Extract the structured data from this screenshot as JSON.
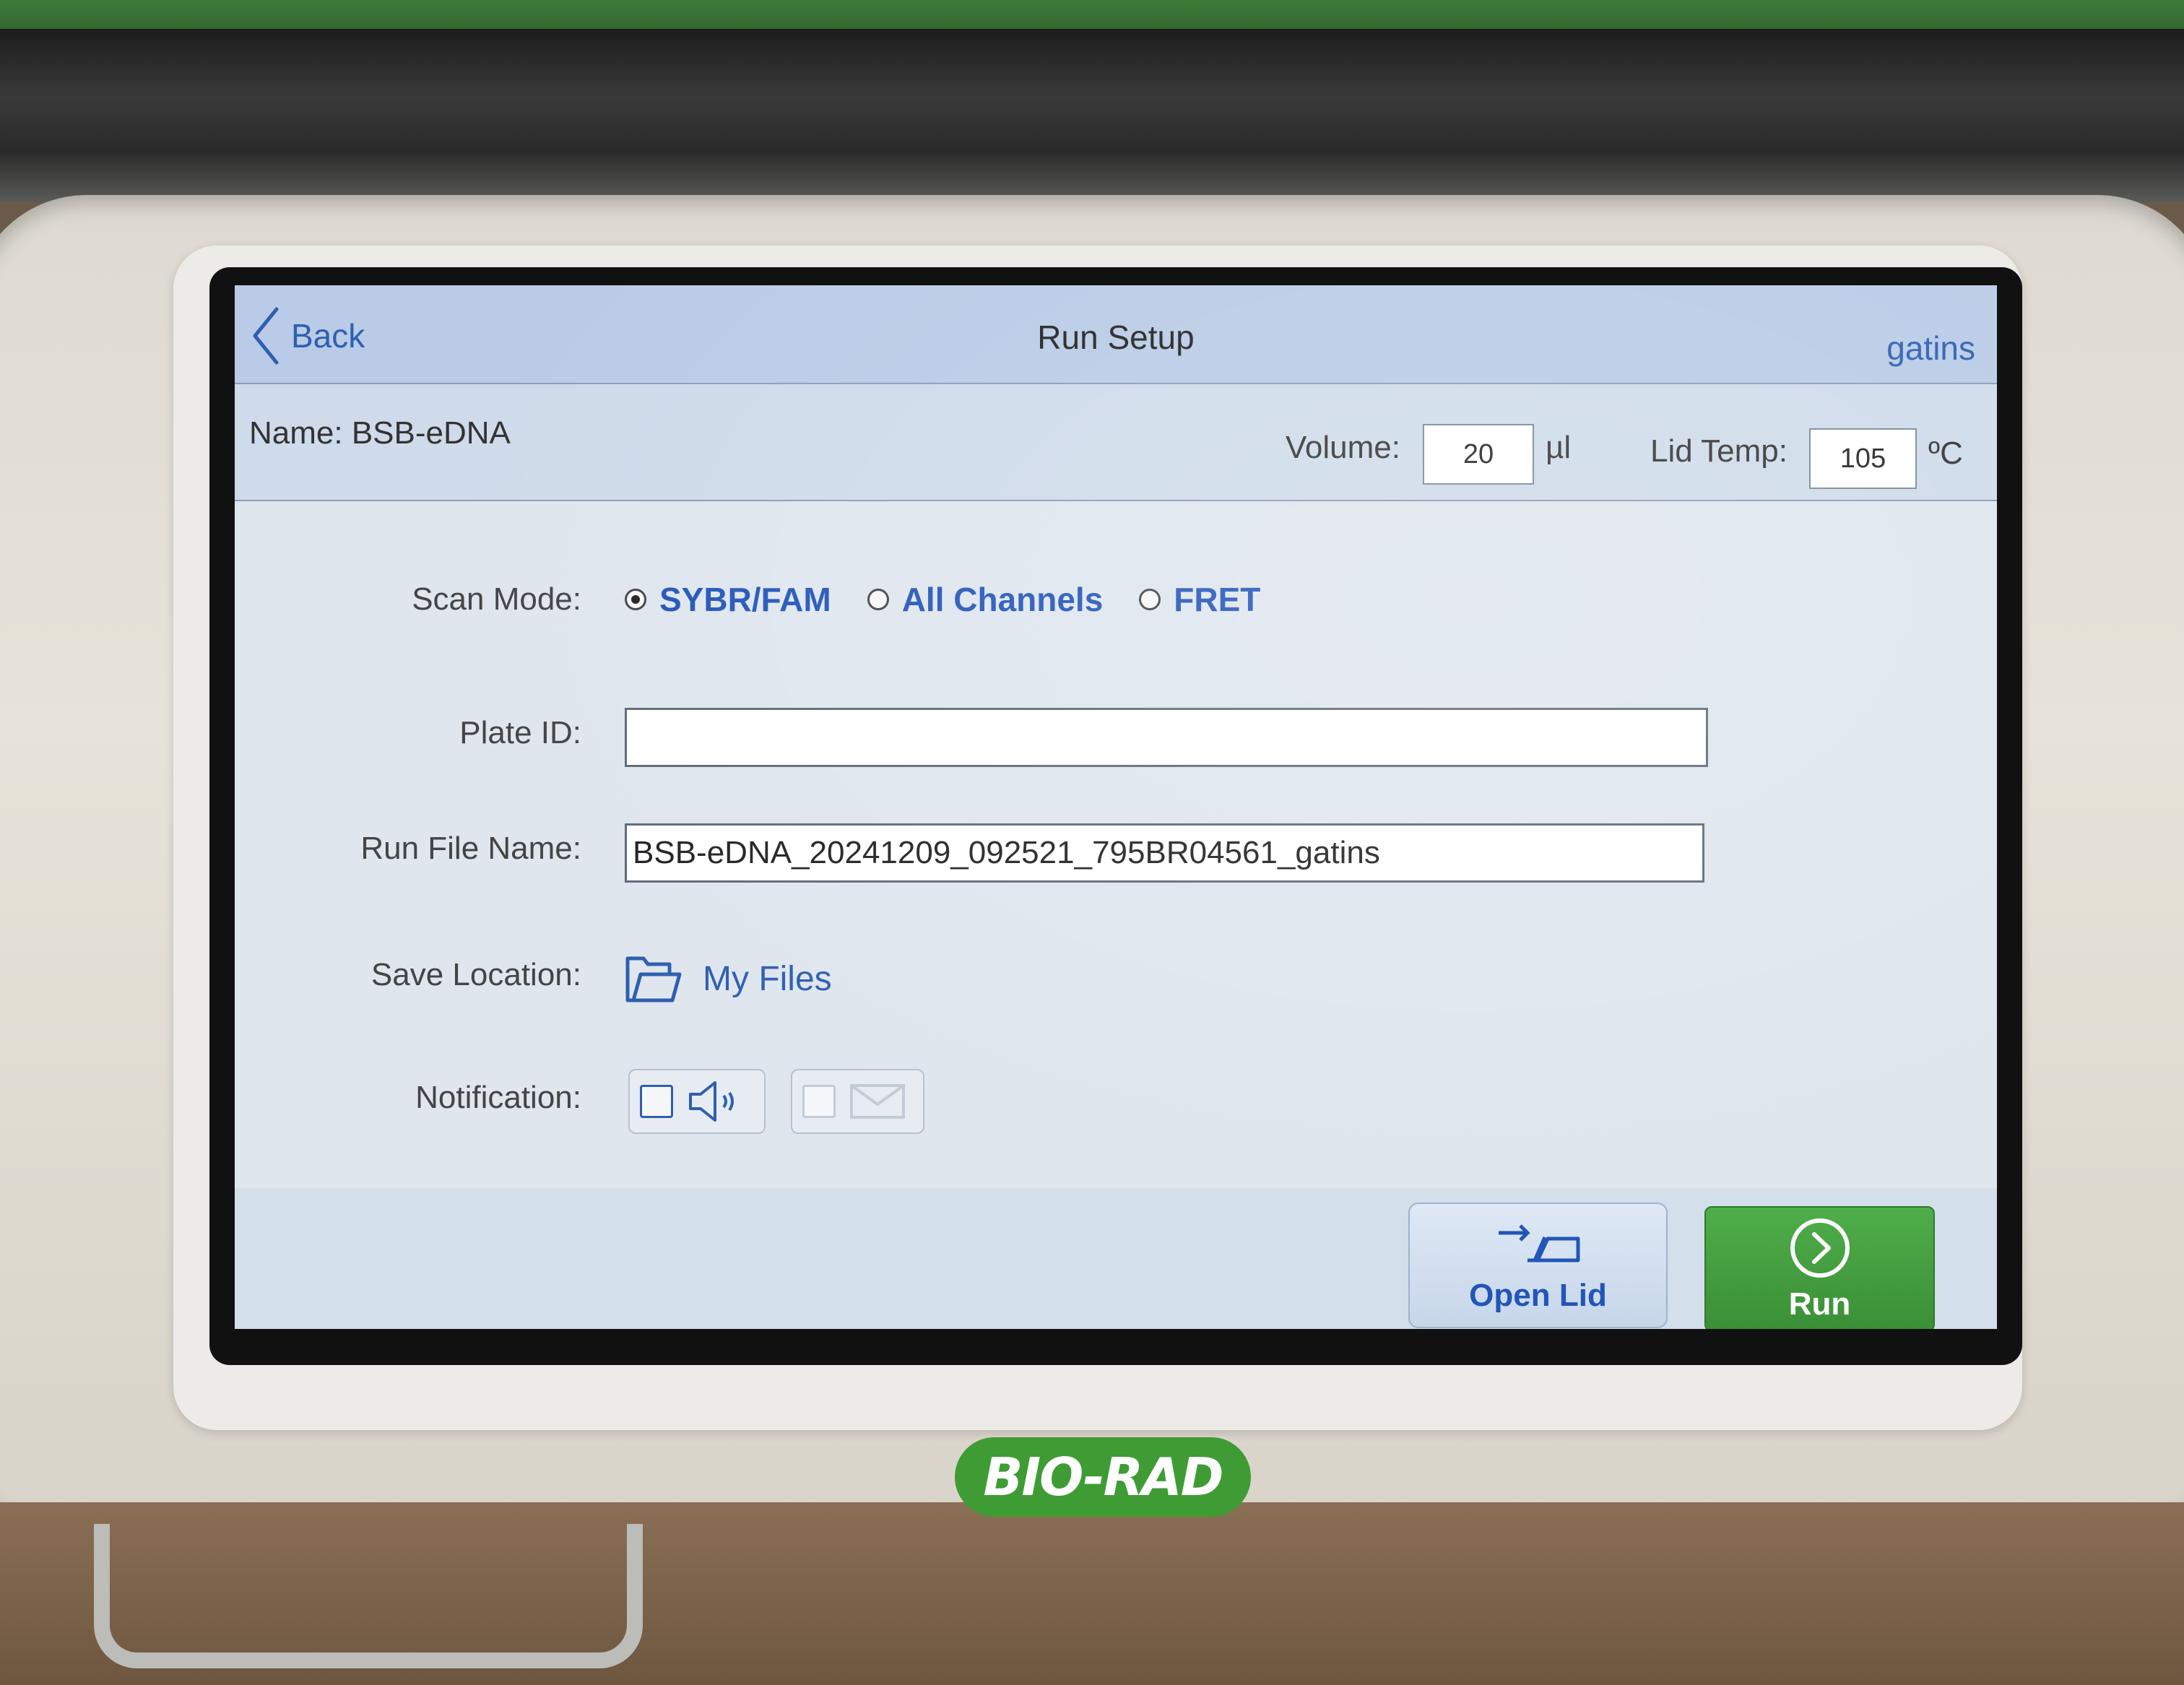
{
  "header": {
    "back_label": "Back",
    "title": "Run Setup",
    "user": "gatins"
  },
  "run_info": {
    "name_label": "Name: BSB-eDNA",
    "volume_label": "Volume:",
    "volume_value": "20",
    "volume_unit": "µl",
    "lid_temp_label": "Lid Temp:",
    "lid_temp_value": "105",
    "lid_temp_unit": "ºC"
  },
  "form": {
    "scan_mode_label": "Scan Mode:",
    "scan_modes": [
      {
        "label": "SYBR/FAM",
        "selected": true
      },
      {
        "label": "All Channels",
        "selected": false
      },
      {
        "label": "FRET",
        "selected": false
      }
    ],
    "plate_id_label": "Plate ID:",
    "plate_id_value": "",
    "run_file_label": "Run File Name:",
    "run_file_value": "BSB-eDNA_20241209_092521_795BR04561_gatins",
    "save_location_label": "Save Location:",
    "save_location_value": "My Files",
    "notification_label": "Notification:"
  },
  "footer": {
    "open_lid_label": "Open Lid",
    "run_label": "Run"
  },
  "device": {
    "brand": "BIO-RAD"
  },
  "colors": {
    "accent_blue": "#2255b8",
    "run_green": "#3f9c35",
    "header_bg": "#b9cbe6"
  }
}
